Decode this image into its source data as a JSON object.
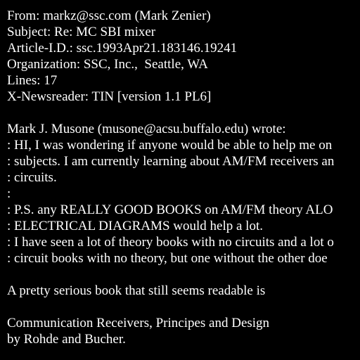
{
  "header": {
    "from": "From: markz@ssc.com (Mark Zenier)",
    "subject": "Subject: Re: MC SBI mixer",
    "article_id": "Article-I.D.: ssc.1993Apr21.183146.19241",
    "organization": "Organization: SSC, Inc.,  Seattle, WA",
    "lines": "Lines: 17",
    "newsreader": "X-Newsreader: TIN [version 1.1 PL6]"
  },
  "body": {
    "attribution": "Mark J. Musone (musone@acsu.buffalo.edu) wrote:",
    "quoted": [
      ": HI, I was wondering if anyone would be able to help me on",
      ": subjects. I am currently learning about AM/FM receivers an",
      ": circuits.",
      ":",
      ": P.S. any REALLY GOOD BOOKS on AM/FM theory ALO",
      ": ELECTRICAL DIAGRAMS would help a lot.",
      ": I have seen a lot of theory books with no circuits and a lot o",
      ": circuit books with no theory, but one without the other doe"
    ],
    "reply": "A pretty serious book that still seems readable is",
    "book_title": "Communication Receivers, Principes and Design",
    "book_authors": "by Rohde and Bucher."
  }
}
